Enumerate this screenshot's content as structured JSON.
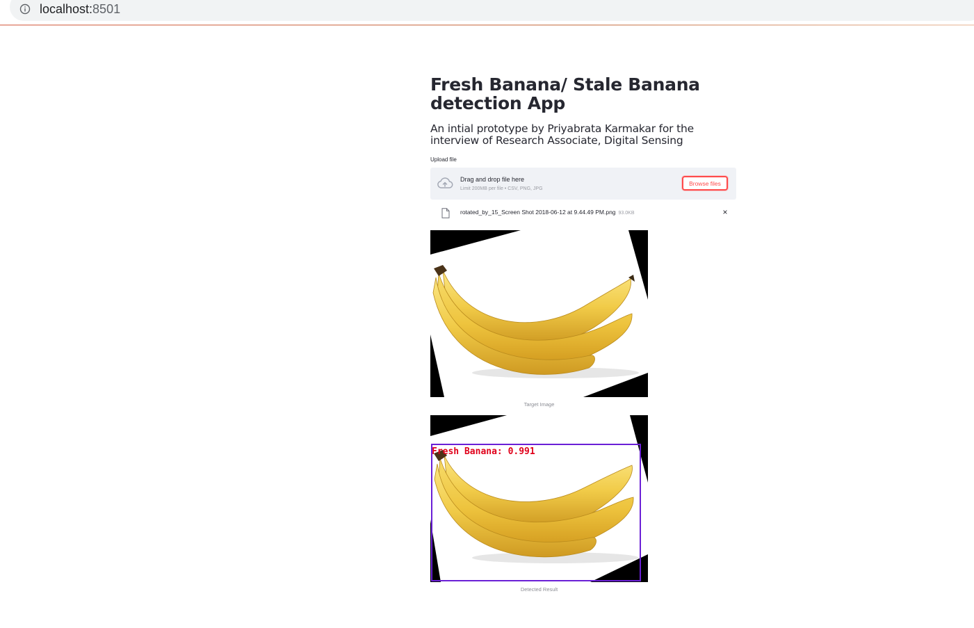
{
  "browser": {
    "url_host": "localhost:",
    "url_port": "8501"
  },
  "app": {
    "title": "Fresh Banana/ Stale Banana detection App",
    "subtitle": "An intial prototype by Priyabrata Karmakar for the interview of Research Associate, Digital Sensing"
  },
  "uploader": {
    "label": "Upload file",
    "drop_text": "Drag and drop file here",
    "limit_text": "Limit 200MB per file • CSV, PNG, JPG",
    "browse_label": "Browse files",
    "file_name": "rotated_by_15_Screen Shot 2018-06-12 at 9.44.49 PM.png",
    "file_size": "93.0KB",
    "remove_glyph": "×"
  },
  "images": {
    "target_caption": "Target Image",
    "result_caption": "Detected Result",
    "detection_label": "Fresh Banana: 0.991"
  },
  "icons": {
    "info": "info-icon",
    "upload": "cloud-upload-icon",
    "file": "file-icon",
    "close": "close-icon"
  },
  "colors": {
    "accent": "#ff4b4b",
    "dropzone_bg": "#f0f2f6",
    "text": "#262730",
    "detection_box": "#6a1fd6",
    "detection_text": "#e0001a"
  }
}
